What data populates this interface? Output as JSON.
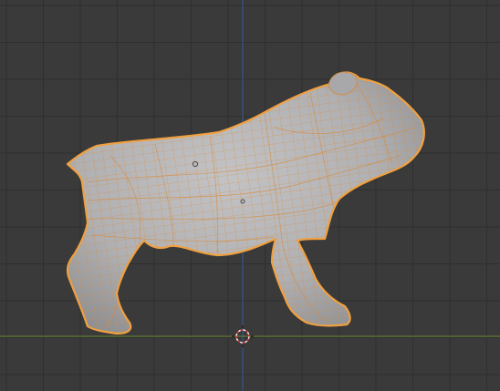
{
  "viewport": {
    "view": "side-orthographic",
    "object": {
      "shape": "bulldog-mesh",
      "mode": "edit",
      "state": "selected"
    },
    "colors": {
      "background": "#3a3a3a",
      "grid_line": "#2f2f2f",
      "axis_x": "#6a8a2e",
      "axis_z": "#2e5f9a",
      "selection_outline": "#f0a040",
      "wire_edges": "#d88a3a",
      "mesh_surface": "#b5b5b7"
    },
    "icons": [
      "3d-cursor-icon",
      "object-origin-icon"
    ]
  }
}
